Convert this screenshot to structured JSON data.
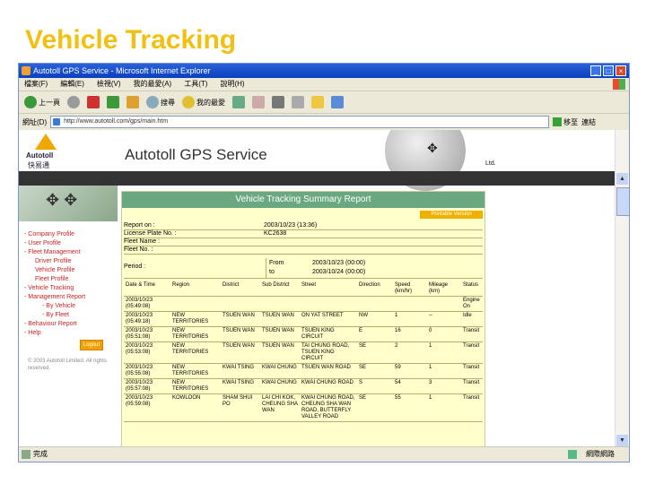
{
  "slide": {
    "title": "Vehicle Tracking"
  },
  "window": {
    "title": "Autotoll GPS Service - Microsoft Internet Explorer",
    "min": "_",
    "max": "□",
    "close": "×"
  },
  "menubar": [
    "檔案(F)",
    "編輯(E)",
    "檢視(V)",
    "我的最愛(A)",
    "工具(T)",
    "說明(H)"
  ],
  "toolbar": {
    "back": "上一頁",
    "search": "搜尋",
    "favorites": "我的最愛"
  },
  "address": {
    "label": "網址(D)",
    "url": "http://www.autotoll.com/gps/main.htm",
    "go": "移至",
    "links": "連結"
  },
  "status": {
    "left": "完成",
    "right": "網際網路"
  },
  "banner": {
    "logo": "Autotoll",
    "logo_cn": "快易通",
    "brand": "Autotoll GPS Service",
    "tail": "Ltd."
  },
  "sidebar": {
    "items": [
      {
        "label": "- Company Profile",
        "level": 0
      },
      {
        "label": "- User Profile",
        "level": 0
      },
      {
        "label": "- Fleet Management",
        "level": 0
      },
      {
        "label": "Driver Profile",
        "level": 1
      },
      {
        "label": "Vehicle Profile",
        "level": 1
      },
      {
        "label": "Fleet Profile",
        "level": 1
      },
      {
        "label": "- Vehicle Tracking",
        "level": 0
      },
      {
        "label": "- Management Report",
        "level": 0
      },
      {
        "label": "- By Vehicle",
        "level": 2
      },
      {
        "label": "- By Fleet",
        "level": 2
      },
      {
        "label": "- Behaviour Report",
        "level": 0
      },
      {
        "label": "- Help",
        "level": 0
      }
    ],
    "logout": "Logout",
    "copyright": "© 2003 Autotoll Limited. All rights reserved."
  },
  "report": {
    "title": "Vehicle Tracking Summary Report",
    "print_button": "Printable Version",
    "report_date_label": "Report on :",
    "report_date": "2003/10/23 (13:36)",
    "plate_label": "License Plate No. :",
    "plate": "KC2638",
    "fleet_name_label": "Fleet Name :",
    "fleet_no_label": "Fleet No. :",
    "period_label": "Period :",
    "from_label": "From",
    "to_label": "to",
    "from": "2003/10/23 (00:00)",
    "to": "2003/10/24 (00:00)",
    "columns": [
      "Date & Time",
      "Region",
      "District",
      "Sub District",
      "Street",
      "Direction",
      "Speed (km/hr)",
      "Mileage (km)",
      "Status"
    ],
    "rows": [
      [
        "2003/10/23 (05:49:08)",
        "",
        "",
        "",
        "",
        "",
        "",
        "",
        "Engine On"
      ],
      [
        "2003/10/23 (05:49:18)",
        "NEW TERRITORIES",
        "TSUEN WAN",
        "TSUEN WAN",
        "ON YAT STREET",
        "NW",
        "1",
        "--",
        "Idle"
      ],
      [
        "2003/10/23 (05:51:08)",
        "NEW TERRITORIES",
        "TSUEN WAN",
        "TSUEN WAN",
        "TSUEN KING CIRCUIT",
        "E",
        "16",
        "0",
        "Transit"
      ],
      [
        "2003/10/23 (05:53:08)",
        "NEW TERRITORIES",
        "TSUEN WAN",
        "TSUEN WAN",
        "TAI CHUNG ROAD, TSUEN KING CIRCUIT",
        "SE",
        "2",
        "1",
        "Transit"
      ],
      [
        "2003/10/23 (05:55:08)",
        "NEW TERRITORIES",
        "KWAI TSING",
        "KWAI CHUNG",
        "TSUEN WAN ROAD",
        "SE",
        "59",
        "1",
        "Transit"
      ],
      [
        "2003/10/23 (05:57:08)",
        "NEW TERRITORIES",
        "KWAI TSING",
        "KWAI CHUNG",
        "KWAI CHUNG ROAD",
        "S",
        "54",
        "3",
        "Transit"
      ],
      [
        "2003/10/23 (05:59:08)",
        "KOWLOON",
        "SHAM SHUI PO",
        "LAI CHI KOK, CHEUNG SHA WAN",
        "KWAI CHUNG ROAD, CHEUNG SHA WAN ROAD, BUTTERFLY VALLEY ROAD",
        "SE",
        "55",
        "1",
        "Transit"
      ]
    ]
  }
}
